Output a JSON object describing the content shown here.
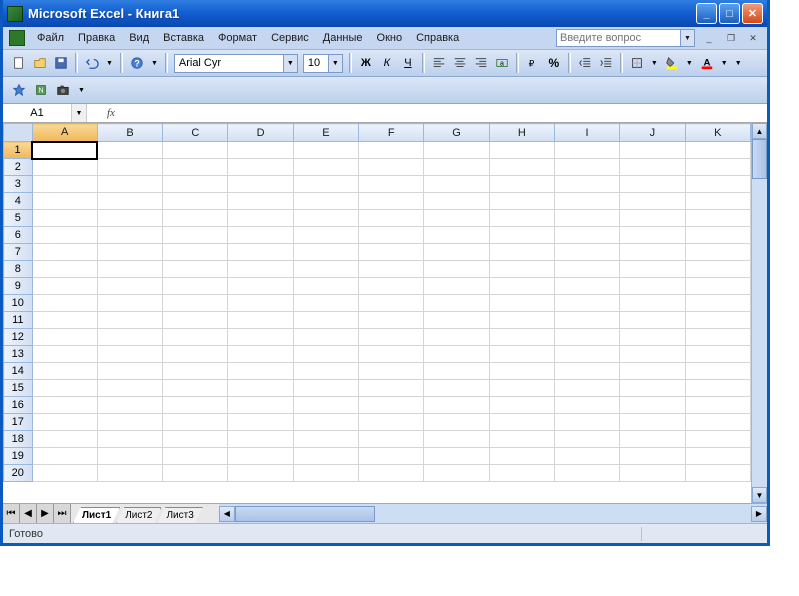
{
  "title": "Microsoft Excel - Книга1",
  "menu": [
    "Файл",
    "Правка",
    "Вид",
    "Вставка",
    "Формат",
    "Сервис",
    "Данные",
    "Окно",
    "Справка"
  ],
  "help_placeholder": "Введите вопрос",
  "font_name": "Arial Cyr",
  "font_size": "10",
  "name_box": "A1",
  "formula": "",
  "columns": [
    "A",
    "B",
    "C",
    "D",
    "E",
    "F",
    "G",
    "H",
    "I",
    "J",
    "K"
  ],
  "rows": [
    "1",
    "2",
    "3",
    "4",
    "5",
    "6",
    "7",
    "8",
    "9",
    "10",
    "11",
    "12",
    "13",
    "14",
    "15",
    "16",
    "17",
    "18",
    "19",
    "20"
  ],
  "active_cell": {
    "row": 0,
    "col": 0
  },
  "sheets": [
    "Лист1",
    "Лист2",
    "Лист3"
  ],
  "active_sheet": 0,
  "status": "Готово",
  "fx_label": "fx"
}
